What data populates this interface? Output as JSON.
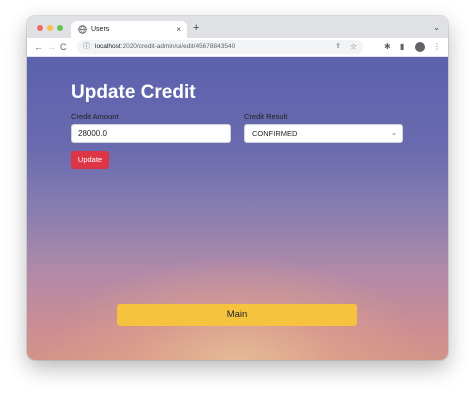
{
  "browser": {
    "tab_title": "Users",
    "tab_close": "×",
    "new_tab": "+",
    "tab_menu": "⌄",
    "nav_back": "←",
    "nav_forward": "→",
    "nav_reload": "C",
    "url_host": "localhost",
    "url_path": ":2020/credit-admin/ui/edit/45678843540"
  },
  "page": {
    "title": "Update Credit",
    "credit_amount_label": "Credit Amount",
    "credit_amount_value": "28000.0",
    "credit_result_label": "Credit Result",
    "credit_result_value": "CONFIRMED",
    "update_button": "Update",
    "main_button": "Main"
  },
  "colors": {
    "update_button": "#dc3545",
    "main_button": "#f6c33f",
    "gradient_top": "#5c62ad",
    "gradient_bottom": "#d39488"
  }
}
